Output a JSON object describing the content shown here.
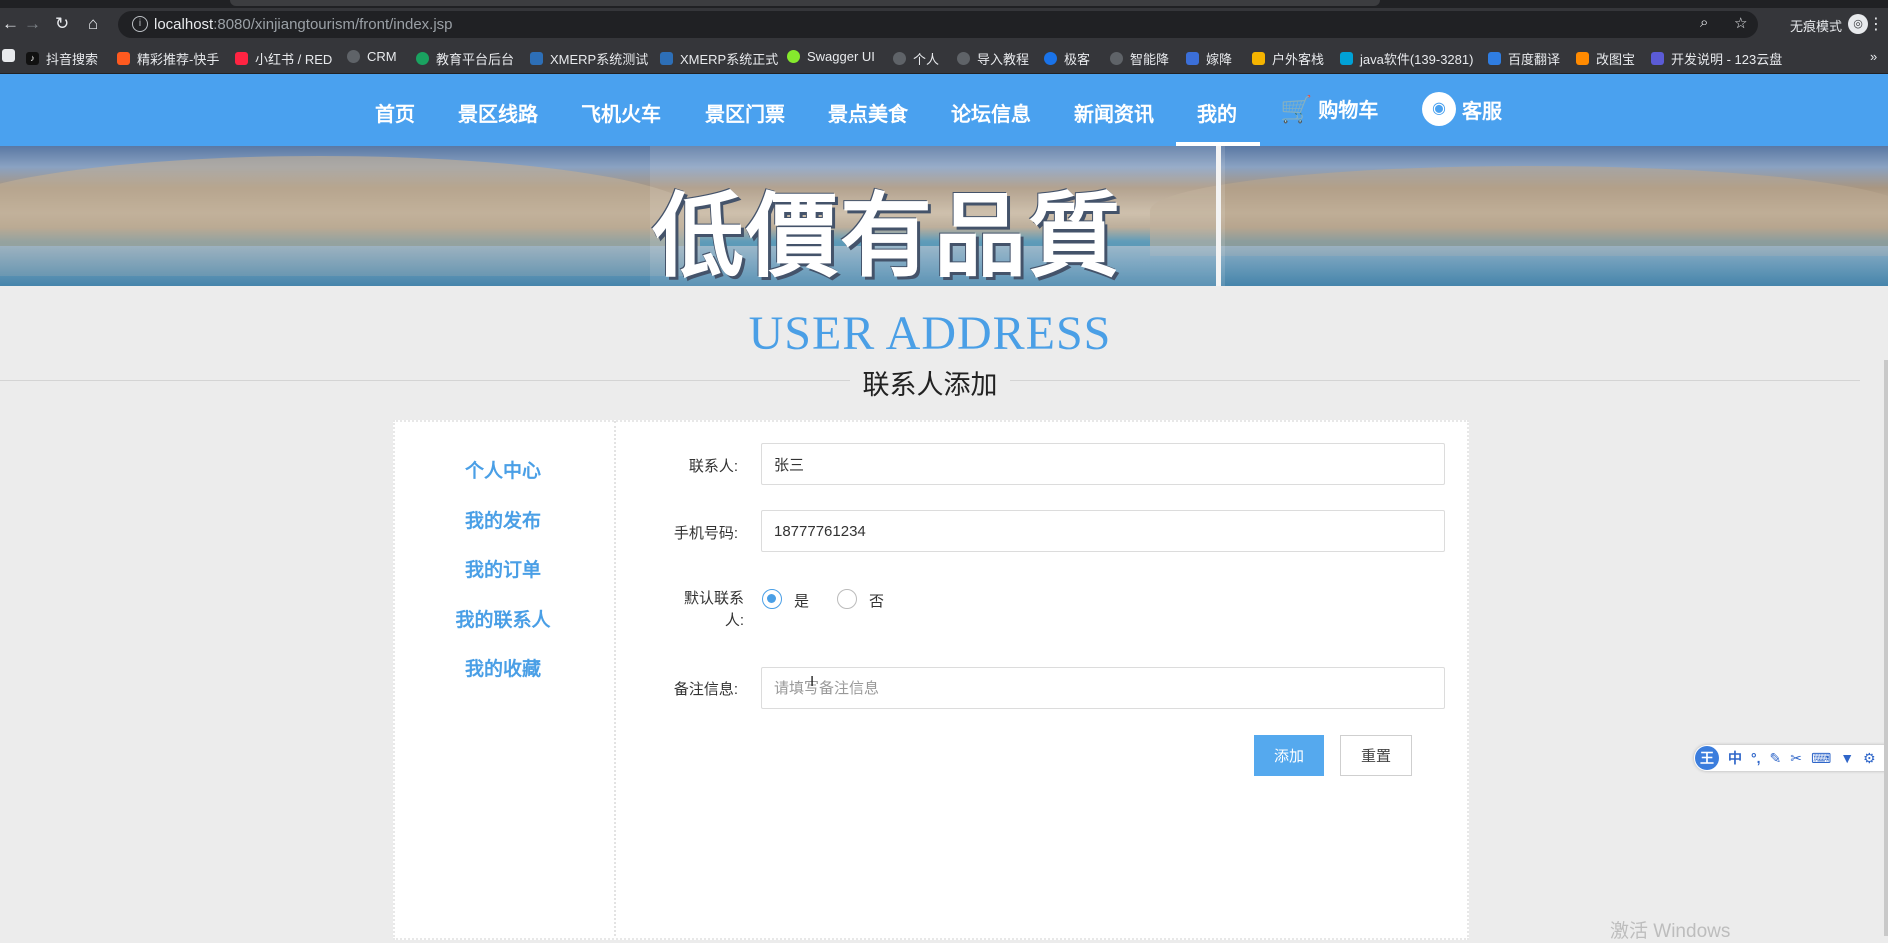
{
  "browser": {
    "url_host": "localhost",
    "url_path": ":8080/xinjiangtourism/front/index.jsp",
    "incognito_label": "无痕模式",
    "bookmarks": [
      {
        "label": "抖音搜索",
        "color": "#111111"
      },
      {
        "label": "精彩推荐-快手",
        "color": "#ff5a1f"
      },
      {
        "label": "小红书 / RED",
        "color": "#ff2442"
      },
      {
        "label": "CRM",
        "color": "#5f6368"
      },
      {
        "label": "教育平台后台",
        "color": "#1aa260"
      },
      {
        "label": "XMERP系统测试",
        "color": "#2d6fb7"
      },
      {
        "label": "XMERP系统正式",
        "color": "#2d6fb7"
      },
      {
        "label": "Swagger UI",
        "color": "#85ea2d"
      },
      {
        "label": "个人",
        "color": "#5f6368"
      },
      {
        "label": "导入教程",
        "color": "#5f6368"
      },
      {
        "label": "极客",
        "color": "#1a73e8"
      },
      {
        "label": "智能降",
        "color": "#5f6368"
      },
      {
        "label": "嫁降",
        "color": "#3b6fd8"
      },
      {
        "label": "户外客栈",
        "color": "#f5b400"
      },
      {
        "label": "java软件(139-3281)",
        "color": "#00a1d6"
      },
      {
        "label": "百度翻译",
        "color": "#2f7de1"
      },
      {
        "label": "改图宝",
        "color": "#ff8a00"
      },
      {
        "label": "开发说明 - 123云盘",
        "color": "#5b5bd6"
      }
    ]
  },
  "nav": {
    "items": [
      "首页",
      "景区线路",
      "飞机火车",
      "景区门票",
      "景点美食",
      "论坛信息",
      "新闻资讯",
      "我的"
    ],
    "cart": "购物车",
    "service": "客服",
    "active": "我的"
  },
  "banner": {
    "text": "低價有品質"
  },
  "heading": {
    "title": "USER ADDRESS",
    "subtitle": "联系人添加"
  },
  "sidebar": {
    "items": [
      "个人中心",
      "我的发布",
      "我的订单",
      "我的联系人",
      "我的收藏"
    ]
  },
  "form": {
    "contact_label": "联系人:",
    "contact_value": "张三",
    "phone_label": "手机号码:",
    "phone_value": "18777761234",
    "default_label_1": "默认联系",
    "default_label_2": "人:",
    "default_yes": "是",
    "default_no": "否",
    "default_selected": "是",
    "note_label": "备注信息:",
    "note_placeholder": "请填写备注信息",
    "add_button": "添加",
    "reset_button": "重置"
  },
  "ime": {
    "lang": "中"
  },
  "watermark": "激活 Windows",
  "colors": {
    "accent": "#4aa1ef",
    "link": "#4a9fe6",
    "button": "#55a9ee"
  }
}
